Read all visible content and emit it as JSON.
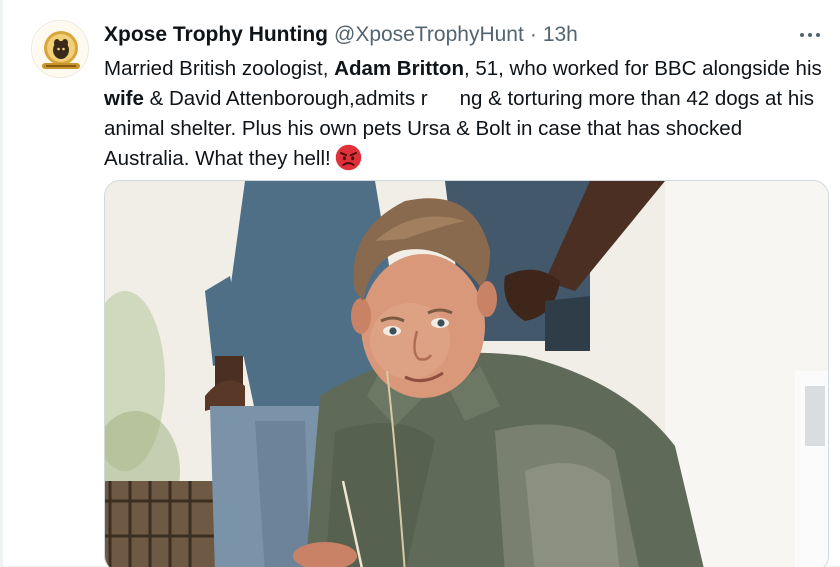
{
  "tweet": {
    "author_name": "Xpose Trophy Hunting",
    "handle": "@XposeTrophyHunt",
    "separator": "·",
    "time": "13h",
    "text_parts": {
      "p1": "Married British zoologist, ",
      "b1": "Adam Britton",
      "p2": ", 51, who worked for BBC alongside his ",
      "b2": "wife",
      "p3": " & David Attenborough,admits r",
      "p4": "ng & torturing more than 42 dogs at his animal shelter. Plus his own pets Ursa & Bolt in case that has shocked Australia. What they hell!"
    },
    "emoji": "angry-face-emoji",
    "avatar_icon": "trophy-hunting-logo-icon",
    "more_icon": "more-options-icon"
  },
  "media": {
    "photo": "photo-man-kneeling-with-two-people-standing-behind"
  },
  "colors": {
    "text_primary": "#0f1419",
    "text_secondary": "#536471",
    "border": "#cfd9de",
    "accent": "#1d9bf0",
    "emoji_red": "#e0313a"
  }
}
